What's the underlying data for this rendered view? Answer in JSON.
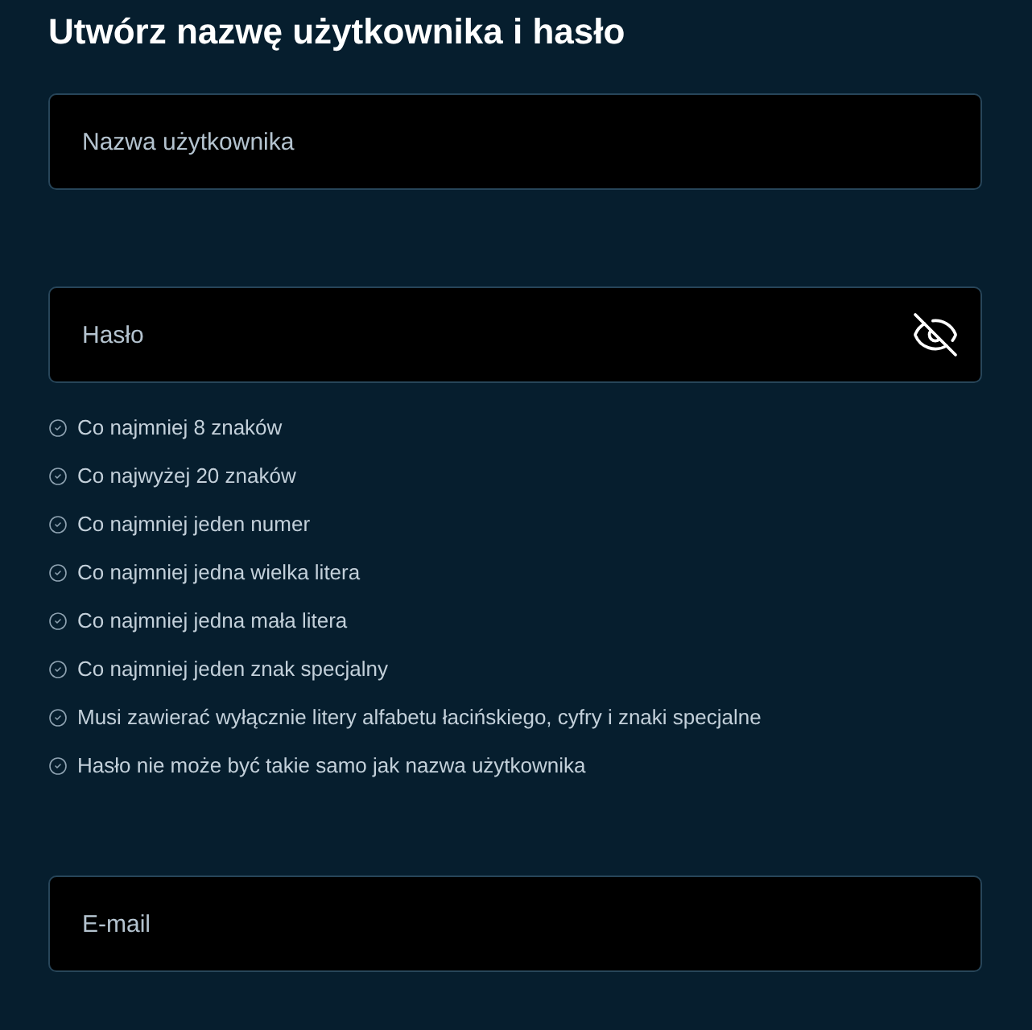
{
  "title": "Utwórz nazwę użytkownika i hasło",
  "username_field": {
    "placeholder": "Nazwa użytkownika"
  },
  "password_field": {
    "placeholder": "Hasło"
  },
  "password_rules": [
    "Co najmniej 8 znaków",
    "Co najwyżej 20 znaków",
    "Co najmniej jeden numer",
    "Co najmniej jedna wielka litera",
    "Co najmniej jedna mała litera",
    "Co najmniej jeden znak specjalny",
    "Musi zawierać wyłącznie litery alfabetu łacińskiego, cyfry i znaki specjalne",
    "Hasło nie może być takie samo jak nazwa użytkownika"
  ],
  "email_field": {
    "placeholder": "E-mail"
  }
}
